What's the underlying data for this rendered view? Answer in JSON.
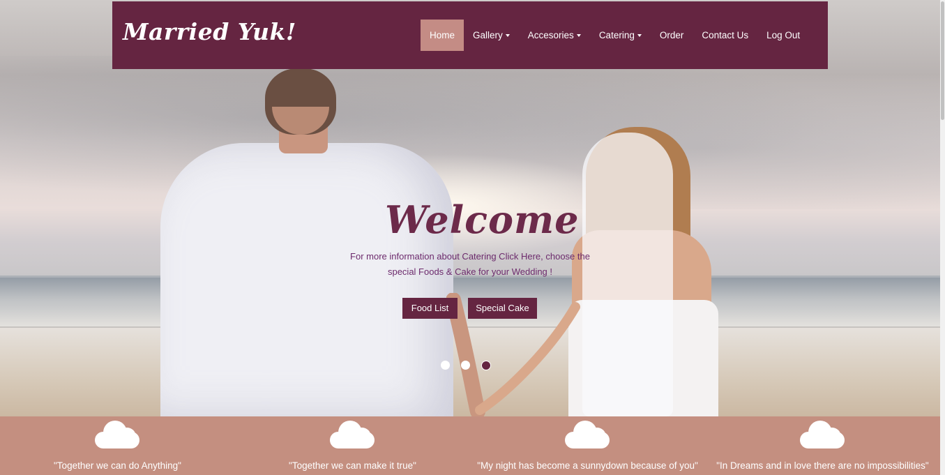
{
  "brand": {
    "name": "Married Yuk!"
  },
  "nav": {
    "items": [
      {
        "label": "Home",
        "active": true,
        "dropdown": false
      },
      {
        "label": "Gallery",
        "active": false,
        "dropdown": true
      },
      {
        "label": "Accesories",
        "active": false,
        "dropdown": true
      },
      {
        "label": "Catering",
        "active": false,
        "dropdown": true
      },
      {
        "label": "Order",
        "active": false,
        "dropdown": false
      },
      {
        "label": "Contact Us",
        "active": false,
        "dropdown": false
      },
      {
        "label": "Log Out",
        "active": false,
        "dropdown": false
      }
    ]
  },
  "hero": {
    "title": "Welcome",
    "text_line1": "For more information about Catering Click Here, choose the",
    "text_line2": "special Foods & Cake for your Wedding !",
    "buttons": {
      "food": "Food List",
      "cake": "Special Cake"
    },
    "slides": {
      "count": 3,
      "active_index": 2
    }
  },
  "quotes": [
    {
      "text": "\"Together we can do Anything\"",
      "icon": "cloud-icon"
    },
    {
      "text": "\"Together we can make it true\"",
      "icon": "cloud-icon"
    },
    {
      "text": "\"My night has become a sunnydown because of you\"",
      "icon": "cloud-icon"
    },
    {
      "text": "\"In Dreams and in love there are no impossibilities\"",
      "icon": "cloud-icon"
    }
  ],
  "colors": {
    "primary": "#652541",
    "accent": "#c48c85",
    "quote_bar": "#c48f80",
    "title": "#6c2a4a"
  }
}
